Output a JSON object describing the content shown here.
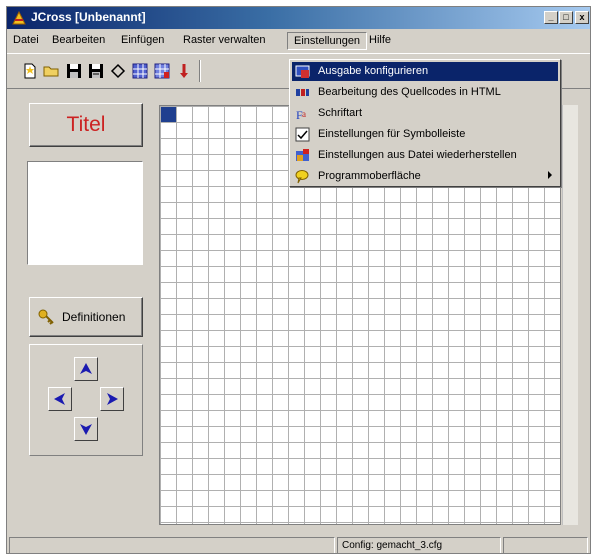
{
  "window": {
    "title": "JCross [Unbenannt]"
  },
  "title_controls": {
    "minimize": "_",
    "maximize": "□",
    "close": "x"
  },
  "menu": {
    "items": [
      "Datei",
      "Bearbeiten",
      "Einfügen",
      "Raster verwalten",
      "Einstellungen",
      "Hilfe"
    ],
    "open_index": 4
  },
  "dropdown": {
    "items": [
      {
        "label": "Ausgabe konfigurieren",
        "icon": "output-config-icon",
        "highlighted": true
      },
      {
        "label": "Bearbeitung des Quellcodes in HTML",
        "icon": "html-source-icon"
      },
      {
        "label": "Schriftart",
        "icon": "font-icon"
      },
      {
        "label": "Einstellungen für Symbolleiste",
        "icon": "toolbar-settings-icon"
      },
      {
        "label": "Einstellungen aus Datei wiederherstellen",
        "icon": "restore-settings-icon"
      },
      {
        "label": "Programmoberfläche",
        "icon": "interface-icon",
        "submenu": true
      }
    ]
  },
  "toolbar": {
    "buttons": [
      "new-file-icon",
      "open-folder-icon",
      "save-icon",
      "save-as-icon",
      "web-icon",
      "grid-icon",
      "grid-edit-icon",
      "pin-icon"
    ]
  },
  "side_panel": {
    "title_button": "Titel",
    "definitions_button": "Definitionen"
  },
  "navigation": {
    "arrows": [
      "arrow-up-icon",
      "arrow-left-icon",
      "arrow-right-icon",
      "arrow-down-icon"
    ]
  },
  "status": {
    "config": "Config: gemacht_3.cfg"
  },
  "colors": {
    "title_red": "#cc2222",
    "highlight": "#0a246a",
    "arrow_blue": "#1a1ab0",
    "selected_cell": "#1f3f8f"
  }
}
